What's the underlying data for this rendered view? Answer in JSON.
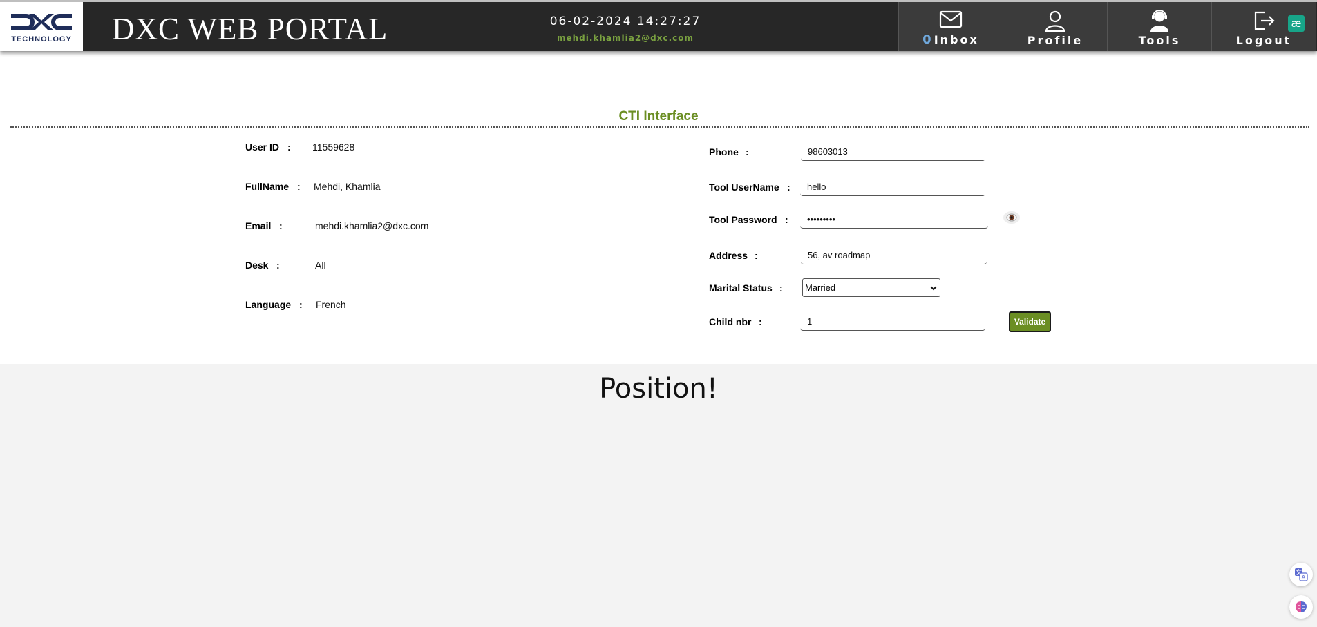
{
  "header": {
    "logo_text": "TECHNOLOGY",
    "logo_mark_alt": "DXC",
    "title": "DXC WEB PORTAL",
    "datetime": "06-02-2024 14:27:27",
    "email": "mehdi.khamlia2@dxc.com",
    "nav": {
      "inbox_count": "0",
      "inbox_label": "Inbox",
      "profile_label": "Profile",
      "tools_label": "Tools",
      "logout_label": "Logout"
    },
    "extension_badge": "æ"
  },
  "section": {
    "title": "CTI Interface"
  },
  "user_info": {
    "user_id_label": "User ID",
    "user_id_value": "11559628",
    "fullname_label": "FullName",
    "fullname_value": "Mehdi, Khamlia",
    "email_label": "Email",
    "email_value": "mehdi.khamlia2@dxc.com",
    "desk_label": "Desk",
    "desk_value": "All",
    "language_label": "Language",
    "language_value": "French",
    "colon": ":"
  },
  "form": {
    "phone_label": "Phone",
    "phone_value": "98603013",
    "tool_username_label": "Tool UserName",
    "tool_username_value": "hello",
    "tool_password_label": "Tool Password",
    "tool_password_value": "•••••••••",
    "address_label": "Address",
    "address_value": "56, av roadmap",
    "marital_status_label": "Marital Status",
    "marital_status_value": "Married",
    "child_nbr_label": "Child nbr",
    "child_nbr_value": "1",
    "validate_label": "Validate"
  },
  "bottom": {
    "heading": "Position!"
  },
  "icons": {
    "inbox": "envelope-icon",
    "profile": "user-icon",
    "tools": "support-agent-icon",
    "logout": "logout-icon",
    "show_password": "eye-icon",
    "translate": "translate-icon",
    "brain": "brain-icon"
  },
  "colors": {
    "header_bg": "#272727",
    "accent_green": "#6b8e23",
    "email_green": "#7aa140",
    "inbox_count_blue": "#6fa8dc"
  }
}
